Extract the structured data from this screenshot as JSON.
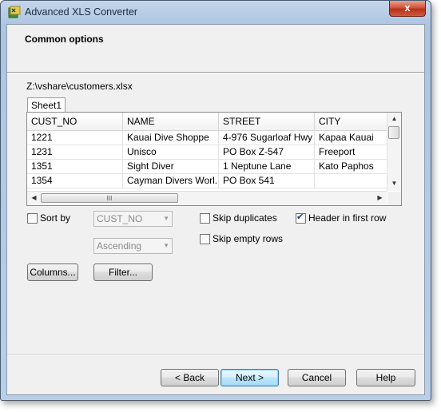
{
  "window": {
    "title": "Advanced XLS Converter",
    "close_label": "x"
  },
  "header": {
    "title": "Common options"
  },
  "file_path": "Z:\\vshare\\customers.xlsx",
  "sheet_tab": "Sheet1",
  "table": {
    "columns": [
      "CUST_NO",
      "NAME",
      "STREET",
      "CITY"
    ],
    "rows": [
      [
        "1221",
        "Kauai Dive Shoppe",
        "4-976 Sugarloaf Hwy",
        "Kapaa Kauai"
      ],
      [
        "1231",
        "Unisco",
        "PO Box Z-547",
        "Freeport"
      ],
      [
        "1351",
        "Sight Diver",
        "1 Neptune Lane",
        "Kato Paphos"
      ],
      [
        "1354",
        "Cayman Divers Worl...",
        "PO Box 541",
        ""
      ]
    ],
    "scroll_thumb_grip": "III"
  },
  "options": {
    "sort_by_label": "Sort by",
    "sort_by_checked": false,
    "sort_field_value": "CUST_NO",
    "sort_order_value": "Ascending",
    "skip_duplicates_label": "Skip duplicates",
    "skip_duplicates_checked": false,
    "header_first_row_label": "Header in first row",
    "header_first_row_checked": true,
    "skip_empty_rows_label": "Skip empty rows",
    "skip_empty_rows_checked": false
  },
  "buttons": {
    "columns": "Columns...",
    "filter": "Filter...",
    "back": "< Back",
    "next": "Next >",
    "cancel": "Cancel",
    "help": "Help"
  }
}
